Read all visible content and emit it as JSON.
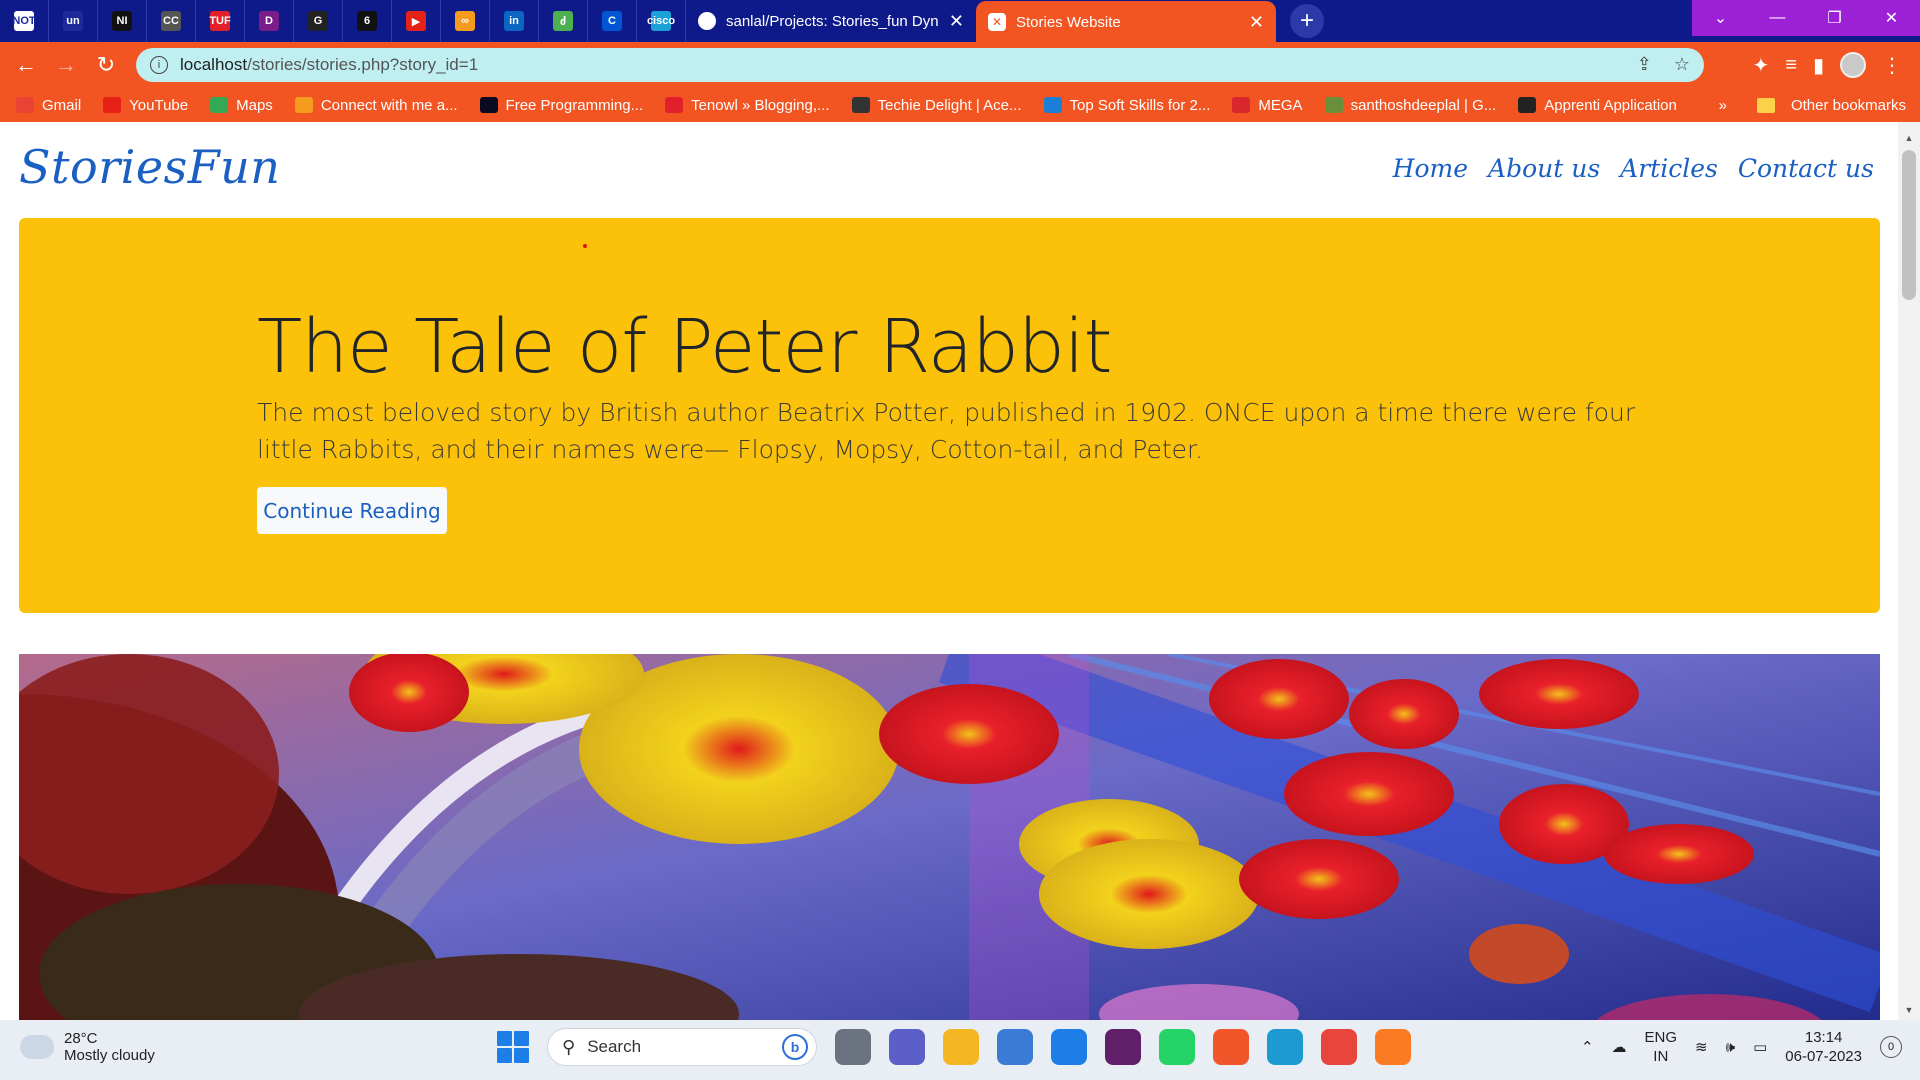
{
  "browser": {
    "pinned_tabs": [
      {
        "icon": "noteworthy-icon",
        "abbr": "NOT",
        "color": "#ffffff"
      },
      {
        "icon": "unstop-icon",
        "abbr": "un",
        "color": "#1d2a99"
      },
      {
        "icon": "naukri-icon",
        "abbr": "NI",
        "color": "#111111"
      },
      {
        "icon": "cc-icon",
        "abbr": "CC",
        "color": "#555555"
      },
      {
        "icon": "tuf-icon",
        "abbr": "TUF",
        "color": "#e2202b"
      },
      {
        "icon": "dsa-icon",
        "abbr": "D",
        "color": "#7a1d8a"
      },
      {
        "icon": "github-icon",
        "abbr": "G",
        "color": "#222222"
      },
      {
        "icon": "codechef-icon",
        "abbr": "6",
        "color": "#111111"
      },
      {
        "icon": "youtube-icon",
        "abbr": "▶",
        "color": "#e62117"
      },
      {
        "icon": "infinity-icon",
        "abbr": "∞",
        "color": "#f59b1e"
      },
      {
        "icon": "linkedin-icon",
        "abbr": "in",
        "color": "#0a66c2"
      },
      {
        "icon": "leaf-icon",
        "abbr": "ძ",
        "color": "#4caf50"
      },
      {
        "icon": "coursera-icon",
        "abbr": "C",
        "color": "#0056d2"
      },
      {
        "icon": "cisco-icon",
        "abbr": "cisco",
        "color": "#1ba0d7"
      }
    ],
    "tabs": [
      {
        "title": "sanlal/Projects: Stories_fun Dynar",
        "active": false
      },
      {
        "title": "Stories Website",
        "active": true
      }
    ],
    "url_host": "localhost",
    "url_path": "/stories/stories.php?story_id=1",
    "bookmarks": [
      {
        "label": "Gmail",
        "icon": "gmail-icon",
        "color": "#ea4335"
      },
      {
        "label": "YouTube",
        "icon": "youtube-icon",
        "color": "#e62117"
      },
      {
        "label": "Maps",
        "icon": "maps-icon",
        "color": "#34a853"
      },
      {
        "label": "Connect with me a...",
        "icon": "connect-icon",
        "color": "#f59b1e"
      },
      {
        "label": "Free Programming...",
        "icon": "freecodecamp-icon",
        "color": "#0a0a23"
      },
      {
        "label": "Tenowl » Blogging,...",
        "icon": "tenowl-icon",
        "color": "#e2202b"
      },
      {
        "label": "Techie Delight | Ace...",
        "icon": "techiedelight-icon",
        "color": "#333333"
      },
      {
        "label": "Top Soft Skills for 2...",
        "icon": "softskills-icon",
        "color": "#1b7fd6"
      },
      {
        "label": "MEGA",
        "icon": "mega-icon",
        "color": "#d9272e"
      },
      {
        "label": "santhoshdeeplal | G...",
        "icon": "github-icon",
        "color": "#6a8f3a"
      },
      {
        "label": "Apprenti Application",
        "icon": "apprenti-icon",
        "color": "#222222"
      }
    ],
    "more_label": "»",
    "other_bookmarks": "Other bookmarks"
  },
  "page": {
    "brand": "StoriesFun",
    "nav": [
      "Home",
      "About us",
      "Articles",
      "Contact us"
    ],
    "hero_title": "The Tale of Peter Rabbit",
    "hero_text": "The most beloved story by British author Beatrix Potter, published in 1902. ONCE upon a time there were four little Rabbits, and their names were— Flopsy, Mopsy, Cotton-tail, and Peter.",
    "hero_button": "Continue Reading",
    "colors": {
      "hero_bg": "#fcc109",
      "link": "#1a5fc2",
      "browser_accent": "#f25422"
    }
  },
  "taskbar": {
    "temperature": "28°C",
    "weather": "Mostly cloudy",
    "search_placeholder": "Search",
    "apps": [
      {
        "icon": "task-view-icon",
        "color": "#6b7280"
      },
      {
        "icon": "teams-icon",
        "color": "#5b5fc7"
      },
      {
        "icon": "file-explorer-icon",
        "color": "#f5b624"
      },
      {
        "icon": "store-icon",
        "color": "#3a7bd5"
      },
      {
        "icon": "help-icon",
        "color": "#1d7ee8"
      },
      {
        "icon": "slack-icon",
        "color": "#611f69"
      },
      {
        "icon": "whatsapp-icon",
        "color": "#25d366"
      },
      {
        "icon": "brave-icon",
        "color": "#f1562b"
      },
      {
        "icon": "edge-icon",
        "color": "#1d9bd1"
      },
      {
        "icon": "chrome-icon",
        "color": "#e8453c"
      },
      {
        "icon": "xampp-icon",
        "color": "#fb7a24"
      }
    ],
    "lang_top": "ENG",
    "lang_bottom": "IN",
    "time": "13:14",
    "date": "06-07-2023",
    "notifications": "0"
  }
}
